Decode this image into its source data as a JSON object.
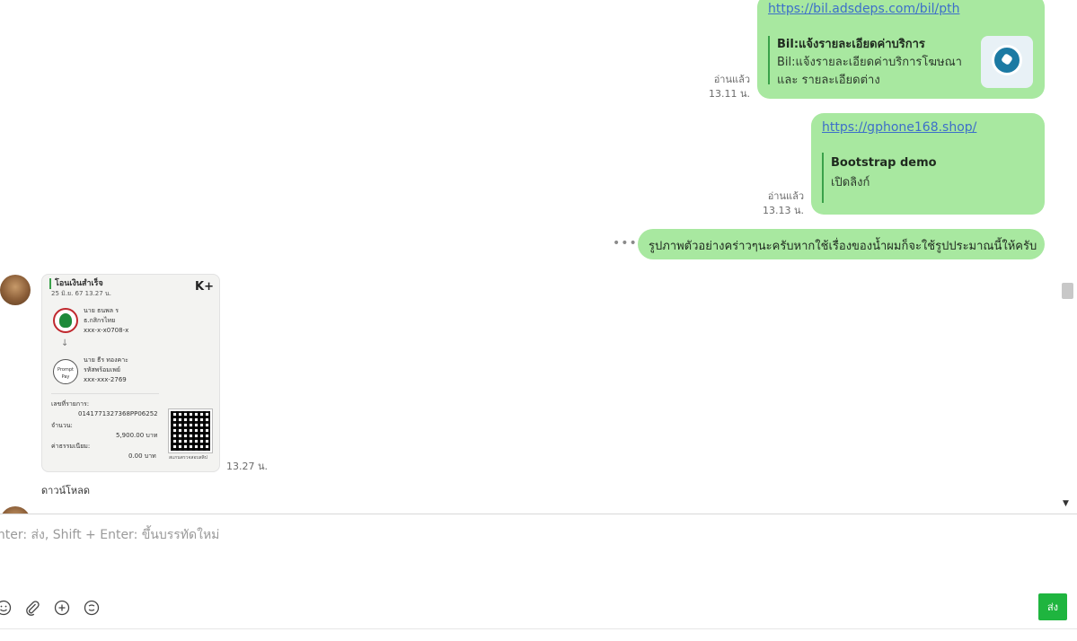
{
  "messages": {
    "msg1": {
      "link": "https://bil.adsdeps.com/bil/pth",
      "preview_title": "Bil:แจ้งรายละเอียดค่าบริการ",
      "preview_desc_line1": "Bil:แจ้งรายละเอียดค่าบริการโฆษณา",
      "preview_desc_line2": "และ รายละเอียดต่าง",
      "read_status": "อ่านแล้ว",
      "time": "13.11 น."
    },
    "msg2": {
      "link": "https://gphone168.shop/",
      "preview_title": "Bootstrap demo",
      "preview_desc": "เปิดลิงก์",
      "read_status": "อ่านแล้ว",
      "time": "13.13 น."
    },
    "msg3": {
      "text": "รูปภาพตัวอย่างคร่าวๆนะครับหากใช้เรื่องของน้ำผมก็จะใช้รูปประมาณนี้ให้ครับ",
      "more_icon": "more-dots-icon"
    },
    "msg4": {
      "receipt_title": "โอนเงินสำเร็จ",
      "receipt_date": "25 มิ.ย. 67  13.27 น.",
      "receipt_brand": "K+",
      "sender_name": "นาย ธนพล ร",
      "sender_bank": "ธ.กสิกรไทย",
      "sender_account": "xxx-x-x0708-x",
      "receiver_name": "นาย ธีร ทองคาะ",
      "receiver_type": "รหัสพร้อมเพย์",
      "receiver_account": "xxx-xxx-2769",
      "ref_label": "เลขที่รายการ:",
      "ref_value": "0141771327368PP06252",
      "amount_label": "จำนวน:",
      "amount_value": "5,900.00 บาท",
      "fee_label": "ค่าธรรมเนียม:",
      "fee_value": "0.00 บาท",
      "qr_caption": "สแกนตรวจสอบสลิป",
      "promptpay_label": "Prompt Pay",
      "time": "13.27 น.",
      "download_label": "ดาวน์โหลด"
    }
  },
  "composer": {
    "placeholder": "Enter: ส่ง, Shift + Enter: ขึ้นบรรทัดใหม่",
    "send_label": "ส่ง",
    "tools": [
      "emoji-icon",
      "paperclip-icon",
      "plus-circle-icon",
      "sticker-icon"
    ]
  },
  "colors": {
    "bubble_green": "#a8e8a0",
    "link_blue": "#3d6fc9",
    "send_green": "#1fb53f"
  }
}
